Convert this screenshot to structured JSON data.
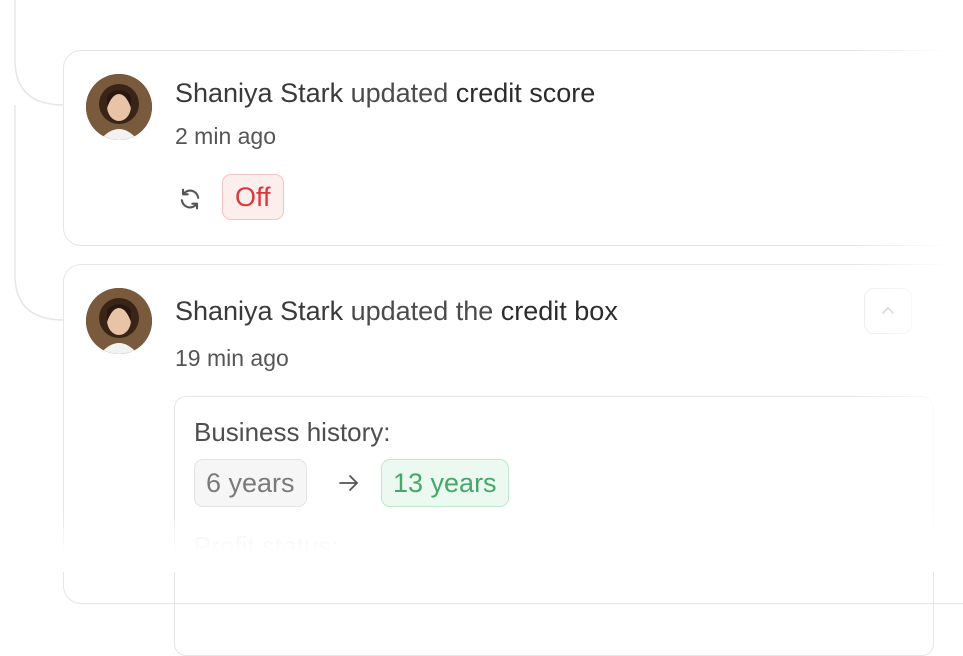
{
  "feed": {
    "items": [
      {
        "actor": "Shaniya Stark",
        "verb": "updated",
        "target": "credit score",
        "time": "2 min ago",
        "icon": "refresh-icon",
        "status": "Off",
        "status_color": "#d83a3a"
      },
      {
        "actor": "Shaniya Stark",
        "verb": "updated the",
        "target": "credit box",
        "time": "19 min ago",
        "expanded": true,
        "details": {
          "label": "Business history:",
          "from": "6 years",
          "to": "13 years",
          "to_color": "#45a86a",
          "next_label": "Profit status:"
        }
      }
    ]
  }
}
